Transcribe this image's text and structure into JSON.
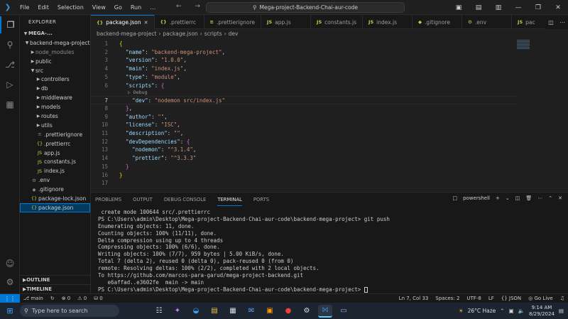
{
  "titlebar": {
    "menus": [
      "File",
      "Edit",
      "Selection",
      "View",
      "Go",
      "Run",
      "…"
    ],
    "command_center": "Mega-project-Backend-Chai-aur-code",
    "search_icon": "search-icon"
  },
  "sidebar": {
    "title": "EXPLORER",
    "root": "MEGA-...",
    "items": [
      {
        "label": "backend-mega-project",
        "depth": 0,
        "type": "folder-open"
      },
      {
        "label": "node_modules",
        "depth": 1,
        "type": "folder",
        "dim": true
      },
      {
        "label": "public",
        "depth": 1,
        "type": "folder"
      },
      {
        "label": "src",
        "depth": 1,
        "type": "folder-open"
      },
      {
        "label": "controllers",
        "depth": 2,
        "type": "folder"
      },
      {
        "label": "db",
        "depth": 2,
        "type": "folder"
      },
      {
        "label": "middleware",
        "depth": 2,
        "type": "folder"
      },
      {
        "label": "models",
        "depth": 2,
        "type": "folder"
      },
      {
        "label": "routes",
        "depth": 2,
        "type": "folder"
      },
      {
        "label": "utils",
        "depth": 2,
        "type": "folder"
      },
      {
        "label": ".prettierignore",
        "depth": 2,
        "type": "ignore"
      },
      {
        "label": ".prettierrc",
        "depth": 2,
        "type": "json"
      },
      {
        "label": "app.js",
        "depth": 2,
        "type": "js"
      },
      {
        "label": "constants.js",
        "depth": 2,
        "type": "js"
      },
      {
        "label": "index.js",
        "depth": 2,
        "type": "js"
      },
      {
        "label": ".env",
        "depth": 1,
        "type": "env"
      },
      {
        "label": ".gitignore",
        "depth": 1,
        "type": "git"
      },
      {
        "label": "package-lock.json",
        "depth": 1,
        "type": "json"
      },
      {
        "label": "package.json",
        "depth": 1,
        "type": "json",
        "selected": true
      }
    ],
    "outline": "OUTLINE",
    "timeline": "TIMELINE"
  },
  "tabs": [
    {
      "label": "package.json",
      "icon": "{}",
      "active": true
    },
    {
      "label": ".prettierrc",
      "icon": "{}"
    },
    {
      "label": ".prettierignore",
      "icon": "≡"
    },
    {
      "label": "app.js",
      "icon": "JS"
    },
    {
      "label": "constants.js",
      "icon": "JS"
    },
    {
      "label": "index.js",
      "icon": "JS"
    },
    {
      "label": ".gitignore",
      "icon": "◆"
    },
    {
      "label": ".env",
      "icon": "⚙"
    },
    {
      "label": "pac",
      "icon": "JS"
    }
  ],
  "breadcrumb": [
    "backend-mega-project",
    "package.json",
    "scripts",
    "dev"
  ],
  "editor": {
    "codelens": "▷ Debug",
    "lines": [
      {
        "n": "1",
        "t": [
          [
            "p",
            "{"
          ]
        ]
      },
      {
        "n": "2",
        "t": [
          [
            "c",
            "  "
          ],
          [
            "k",
            "\"name\""
          ],
          [
            "c",
            ": "
          ],
          [
            "s",
            "\"backend-mega-project\""
          ],
          [
            "c",
            ","
          ]
        ]
      },
      {
        "n": "3",
        "t": [
          [
            "c",
            "  "
          ],
          [
            "k",
            "\"version\""
          ],
          [
            "c",
            ": "
          ],
          [
            "s",
            "\"1.0.0\""
          ],
          [
            "c",
            ","
          ]
        ]
      },
      {
        "n": "4",
        "t": [
          [
            "c",
            "  "
          ],
          [
            "k",
            "\"main\""
          ],
          [
            "c",
            ": "
          ],
          [
            "s",
            "\"index.js\""
          ],
          [
            "c",
            ","
          ]
        ]
      },
      {
        "n": "5",
        "t": [
          [
            "c",
            "  "
          ],
          [
            "k",
            "\"type\""
          ],
          [
            "c",
            ": "
          ],
          [
            "s",
            "\"module\""
          ],
          [
            "c",
            ","
          ]
        ]
      },
      {
        "n": "6",
        "t": [
          [
            "c",
            "  "
          ],
          [
            "k",
            "\"scripts\""
          ],
          [
            "c",
            ": "
          ],
          [
            "p2",
            "{"
          ]
        ]
      },
      {
        "n": "7",
        "t": [
          [
            "c",
            "    "
          ],
          [
            "k",
            "\"dev\""
          ],
          [
            "c",
            ": "
          ],
          [
            "s",
            "\"nodemon src/index.js\""
          ]
        ],
        "cur": true
      },
      {
        "n": "8",
        "t": [
          [
            "c",
            "  "
          ],
          [
            "p2",
            "}"
          ],
          [
            "c",
            ","
          ]
        ]
      },
      {
        "n": "9",
        "t": [
          [
            "c",
            "  "
          ],
          [
            "k",
            "\"author\""
          ],
          [
            "c",
            ": "
          ],
          [
            "s",
            "\"\""
          ],
          [
            "c",
            ","
          ]
        ]
      },
      {
        "n": "10",
        "t": [
          [
            "c",
            "  "
          ],
          [
            "k",
            "\"license\""
          ],
          [
            "c",
            ": "
          ],
          [
            "s",
            "\"ISC\""
          ],
          [
            "c",
            ","
          ]
        ]
      },
      {
        "n": "11",
        "t": [
          [
            "c",
            "  "
          ],
          [
            "k",
            "\"description\""
          ],
          [
            "c",
            ": "
          ],
          [
            "s",
            "\"\""
          ],
          [
            "c",
            ","
          ]
        ]
      },
      {
        "n": "12",
        "t": [
          [
            "c",
            "  "
          ],
          [
            "k",
            "\"devDependencies\""
          ],
          [
            "c",
            ": "
          ],
          [
            "p2",
            "{"
          ]
        ]
      },
      {
        "n": "13",
        "t": [
          [
            "c",
            "    "
          ],
          [
            "k",
            "\"nodemon\""
          ],
          [
            "c",
            ": "
          ],
          [
            "s",
            "\"^3.1.4\""
          ],
          [
            "c",
            ","
          ]
        ]
      },
      {
        "n": "14",
        "t": [
          [
            "c",
            "    "
          ],
          [
            "k",
            "\"prettier\""
          ],
          [
            "c",
            ": "
          ],
          [
            "s",
            "\"^3.3.3\""
          ]
        ]
      },
      {
        "n": "15",
        "t": [
          [
            "c",
            "  "
          ],
          [
            "p2",
            "}"
          ]
        ]
      },
      {
        "n": "16",
        "t": [
          [
            "p",
            "}"
          ]
        ]
      },
      {
        "n": "17",
        "t": []
      }
    ]
  },
  "panel": {
    "tabs": [
      "PROBLEMS",
      "OUTPUT",
      "DEBUG CONSOLE",
      "TERMINAL",
      "PORTS"
    ],
    "active_tab": "TERMINAL",
    "shell": "powershell",
    "terminal": [
      " create mode 100644 src/.prettierrc",
      "PS C:\\Users\\admin\\Desktop\\Mega-project-Backend-Chai-aur-code\\backend-mega-project> git push",
      "Enumerating objects: 11, done.",
      "Counting objects: 100% (11/11), done.",
      "Delta compression using up to 4 threads",
      "Compressing objects: 100% (6/6), done.",
      "Writing objects: 100% (7/7), 959 bytes | 5.00 KiB/s, done.",
      "Total 7 (delta 2), reused 0 (delta 0), pack-reused 0 (from 0)",
      "remote: Resolving deltas: 100% (2/2), completed with 2 local objects.",
      "To https://github.com/marcos-para-garud/mega-project-backend.git",
      "   e6affad..e3602fe  main -> main",
      "PS C:\\Users\\admin\\Desktop\\Mega-project-Backend-Chai-aur-code\\backend-mega-project> "
    ]
  },
  "statusbar": {
    "branch": "main",
    "sync": "↻",
    "errors": "⊗ 0",
    "warnings": "⚠ 0",
    "ports": "⛁ 0",
    "position": "Ln 7, Col 33",
    "spaces": "Spaces: 2",
    "encoding": "UTF-8",
    "eol": "LF",
    "language": "{} JSON",
    "golive": "Go Live"
  },
  "taskbar": {
    "search_placeholder": "Type here to search",
    "weather": "26°C  Haze",
    "time": "9:14 AM",
    "date": "8/29/2024",
    "apps": [
      "☷",
      "✦",
      "◒",
      "▤",
      "▦",
      "✉",
      "▣",
      "●",
      "⚙",
      "⨝",
      "▭"
    ]
  },
  "colors": {
    "accent": "#0078d4",
    "string": "#ce9178",
    "key": "#9cdcfe",
    "brace": "#ffd700",
    "brace2": "#da70d6"
  }
}
